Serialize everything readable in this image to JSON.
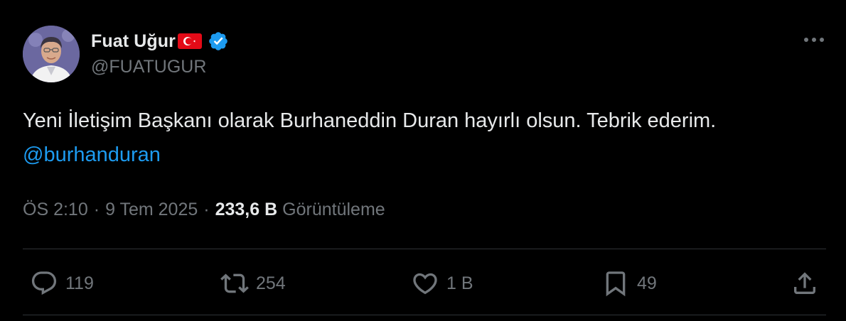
{
  "author": {
    "display_name": "Fuat Uğur",
    "handle": "@FUATUGUR",
    "flag_icon": "turkey-flag-icon",
    "verified_icon": "verified-badge-icon"
  },
  "tweet": {
    "text_main": "Yeni İletişim Başkanı olarak Burhaneddin Duran hayırlı olsun. Tebrik ederim. ",
    "mention": "@burhanduran"
  },
  "meta": {
    "time": "ÖS 2:10",
    "separator": "·",
    "date": "9 Tem 2025",
    "views_count": "233,6 B",
    "views_label": "Görüntüleme"
  },
  "actions": {
    "replies": "119",
    "retweets": "254",
    "likes": "1 B",
    "bookmarks": "49"
  },
  "colors": {
    "background": "#000000",
    "text": "#e7e9ea",
    "secondary": "#71767b",
    "accent": "#1d9bf0",
    "divider": "#2f3336"
  }
}
